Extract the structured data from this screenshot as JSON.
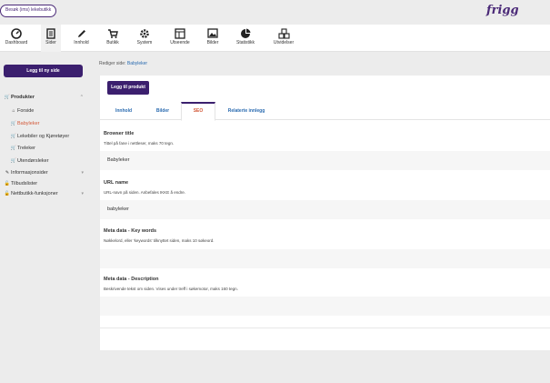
{
  "topbar": {
    "visit_button": "Besøk (ims) lekebutikk",
    "logo": "frigg"
  },
  "toolbar": {
    "items": [
      {
        "label": "Dashboard",
        "icon": "dashboard-icon"
      },
      {
        "label": "Sider",
        "icon": "pages-icon"
      },
      {
        "label": "Innhold",
        "icon": "pencil-icon"
      },
      {
        "label": "Butikk",
        "icon": "cart-icon"
      },
      {
        "label": "System",
        "icon": "gear-icon"
      },
      {
        "label": "Utseende",
        "icon": "layout-icon"
      },
      {
        "label": "Bilder",
        "icon": "image-icon"
      },
      {
        "label": "Statistikk",
        "icon": "pie-chart-icon"
      },
      {
        "label": "Utvidelser",
        "icon": "puzzle-icon"
      }
    ]
  },
  "sidebar": {
    "new_page_button": "Legg til ny side",
    "nav": {
      "produkter": "Produkter",
      "forside": "Forside",
      "babyleker": "Babyleker",
      "lekebiler": "Lekebiler og Kjøretøyer",
      "treleker": "Treleker",
      "utendorsleker": "Utendørsleker",
      "informasjonsider": "Informasjonsider",
      "tilbudslister": "Tilbudslister",
      "nettbutikk": "Nettbutikk-funksjoner"
    }
  },
  "breadcrumb": {
    "prefix": "Rediger side:",
    "current": "Babyleker"
  },
  "panel": {
    "add_product_button": "Legg til produkt",
    "tabs": [
      "Innhold",
      "Bilder",
      "SEO",
      "Relaterte innlegg"
    ],
    "active_tab": "SEO",
    "fields": {
      "browser_title": {
        "label": "Browser title",
        "help": "Tittel på fane i nettleser, maks 70 tegn.",
        "value": "Babyleker"
      },
      "url_name": {
        "label": "URL name",
        "help": "URL-navn på siden. Anbefales IKKE å endre.",
        "value": "babyleker"
      },
      "keywords": {
        "label": "Meta data - Key words",
        "help": "Nøkkelord, eller 'keywords' tilknyttet siden, maks 10 søkeord.",
        "value": ""
      },
      "description": {
        "label": "Meta data - Description",
        "help": "Beskrivende tekst om siden. Vises under treff i søkemotor, maks 160 tegn.",
        "value": ""
      }
    }
  },
  "colors": {
    "brand": "#3b1f6e",
    "link": "#2a6bb0",
    "active": "#d35a3a"
  }
}
